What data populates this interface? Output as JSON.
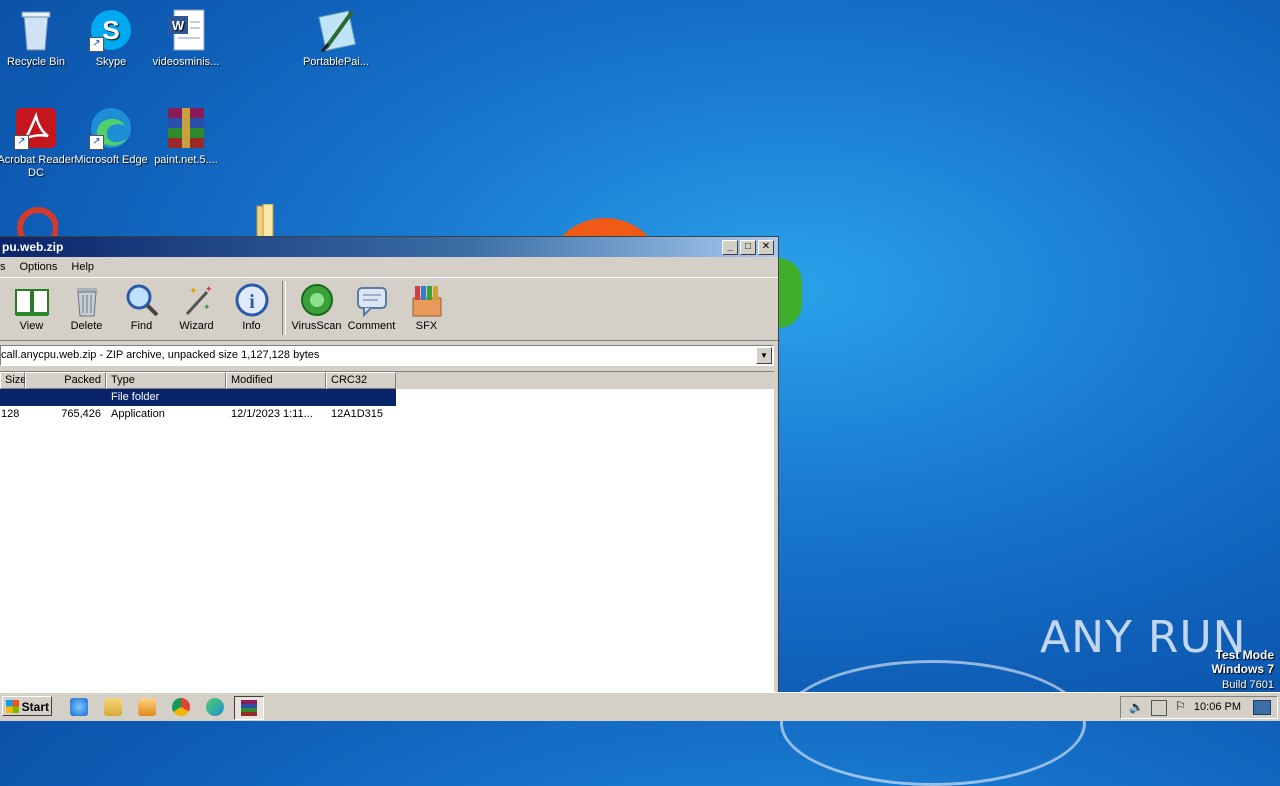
{
  "desktop": {
    "icons": [
      {
        "label": "Recycle Bin",
        "icon": "recycle-bin-icon"
      },
      {
        "label": "Skype",
        "icon": "skype-icon"
      },
      {
        "label": "videosminis...",
        "icon": "word-document-icon"
      },
      {
        "label": "PortablePai...",
        "icon": "portable-paint-icon"
      },
      {
        "label": "Acrobat Reader DC",
        "icon": "acrobat-reader-icon"
      },
      {
        "label": "Microsoft Edge",
        "icon": "edge-icon"
      },
      {
        "label": "paint.net.5....",
        "icon": "winrar-archive-icon"
      }
    ]
  },
  "window": {
    "title": "pu.web.zip",
    "menu": [
      "s",
      "Options",
      "Help"
    ],
    "toolbar": [
      "View",
      "Delete",
      "Find",
      "Wizard",
      "Info",
      "VirusScan",
      "Comment",
      "SFX"
    ],
    "address": "call.anycpu.web.zip - ZIP archive, unpacked size 1,127,128 bytes",
    "columns": [
      "Size",
      "Packed",
      "Type",
      "Modified",
      "CRC32"
    ],
    "rows": [
      {
        "size": "",
        "packed": "",
        "type": "File folder",
        "modified": "",
        "crc": ""
      },
      {
        "size": "128",
        "packed": "765,426",
        "type": "Application",
        "modified": "12/1/2023 1:11...",
        "crc": "12A1D315"
      }
    ]
  },
  "taskbar": {
    "start_label": "Start",
    "clock": "10:06 PM"
  },
  "watermark": {
    "line1": "Test Mode",
    "line2": "Windows 7",
    "line3": "Build 7601",
    "brand": "ANY RUN"
  }
}
